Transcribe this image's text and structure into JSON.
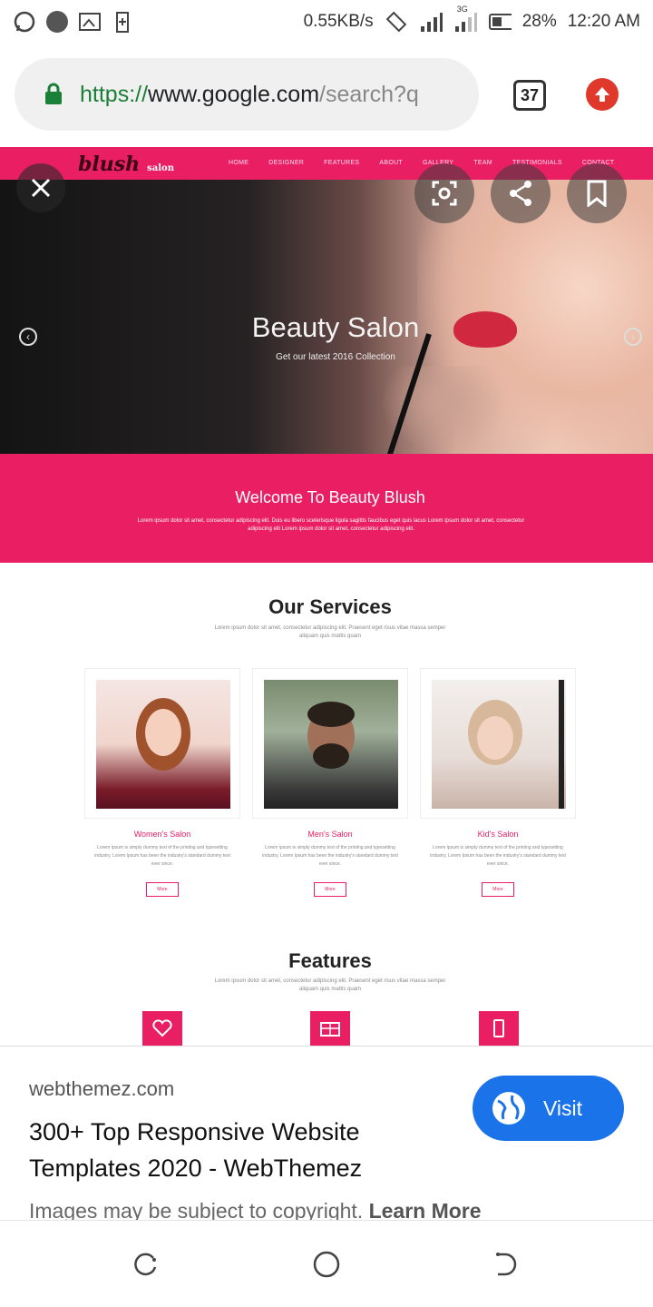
{
  "status_bar": {
    "speed": "0.55KB/s",
    "battery": "28%",
    "time": "12:20 AM",
    "network": "3G",
    "icons": [
      "whatsapp-icon",
      "app-icon",
      "image-icon",
      "battery-plus-icon",
      "rotate-icon",
      "signal-icon",
      "signal-3g-icon",
      "battery-icon"
    ]
  },
  "browser": {
    "url_scheme": "https://",
    "url_host": "www.google.com",
    "url_path": "/search?q",
    "tab_count": "37",
    "lock_color": "#1a7f37",
    "upload_color": "#e0392b"
  },
  "site": {
    "logo": "blush",
    "logo_sub": "salon",
    "nav": [
      "HOME",
      "DESIGNER",
      "FEATURES",
      "ABOUT",
      "GALLERY",
      "TEAM",
      "TESTIMONIALS",
      "CONTACT"
    ],
    "hero_title": "Beauty Salon",
    "hero_sub": "Get our latest 2016 Collection",
    "welcome_title": "Welcome To Beauty Blush",
    "welcome_text": "Lorem ipsum dolor sit amet, consectetur adipiscing elit. Duis eu libero scelerisque ligula sagittis faucibus eget quis lacus Lorem ipsum dolor sit amet, consectetur adipiscing elit Lorem ipsum dolor sit amet, consectetur adipiscing elit.",
    "services_title": "Our Services",
    "services_sub": "Lorem ipsum dolor sit amet, consectetur adipiscing elit. Praesent eget risus vitae massa semper aliquam quis mattis quam",
    "services": [
      {
        "title": "Women's Salon",
        "text": "Lorem ipsum is simply dummy text of the printing and typesetting industry. Lorem Ipsum has been the industry's standard dummy text ever since.",
        "button": "More"
      },
      {
        "title": "Men's Salon",
        "text": "Lorem ipsum is simply dummy text of the printing and typesetting industry. Lorem Ipsum has been the industry's standard dummy text ever since.",
        "button": "More"
      },
      {
        "title": "Kid's Salon",
        "text": "Lorem ipsum is simply dummy text of the printing and typesetting industry. Lorem Ipsum has been the industry's standard dummy text ever since.",
        "button": "More"
      }
    ],
    "features_title": "Features",
    "features_sub": "Lorem ipsum dolor sit amet, consectetur adipiscing elit. Praesent eget risus vitae massa semper aliquam quis mattis quam",
    "accent": "#e91e63"
  },
  "info": {
    "source": "webthemez.com",
    "title": "300+ Top Responsive Website Templates 2020 - WebThemez",
    "visit": "Visit",
    "copyright": "Images may be subject to copyright.",
    "learn_more": "Learn More",
    "visit_color": "#1a73e8"
  }
}
